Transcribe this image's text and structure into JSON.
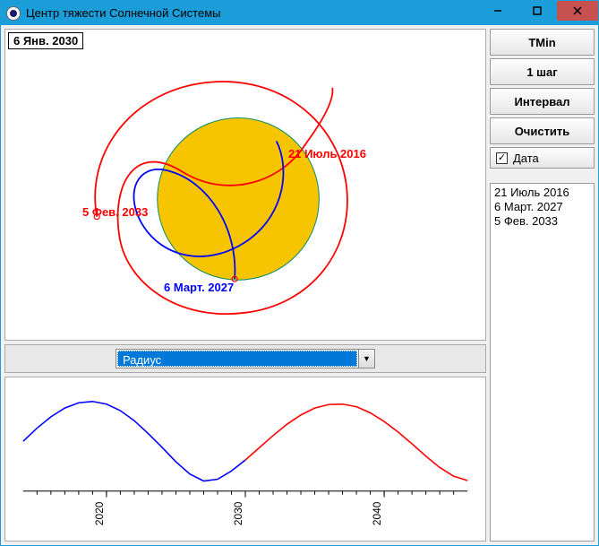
{
  "window": {
    "title": "Центр тяжести Солнечной Системы"
  },
  "canvas": {
    "current_date": "6 Янв. 2030",
    "labels": {
      "start": "21 Июль 2016",
      "mid": "6 Март. 2027",
      "end": "5 Фев. 2033"
    }
  },
  "dropdown": {
    "selected": "Радиус"
  },
  "side": {
    "buttons": {
      "tmin": "TMin",
      "step": "1 шаг",
      "interval": "Интервал",
      "clear": "Очистить"
    },
    "checkbox_label": "Дата",
    "checkbox_checked": true,
    "list_items": [
      "21 Июль 2016",
      "6 Март. 2027",
      "5 Фев. 2033"
    ]
  },
  "chart_data": {
    "type": "line",
    "xlabel": "",
    "ylabel": "",
    "x_ticks": [
      "2020",
      "2030",
      "2040"
    ],
    "x_range": [
      2014,
      2046
    ],
    "y_range": [
      0,
      2.2
    ],
    "series": [
      {
        "name": "radius",
        "current_x": 2030,
        "x": [
          2014,
          2015,
          2016,
          2017,
          2018,
          2019,
          2020,
          2021,
          2022,
          2023,
          2024,
          2025,
          2026,
          2027,
          2028,
          2029,
          2030,
          2031,
          2032,
          2033,
          2034,
          2035,
          2036,
          2037,
          2038,
          2039,
          2040,
          2041,
          2042,
          2043,
          2044,
          2045,
          2046
        ],
        "values": [
          1.1,
          1.4,
          1.66,
          1.86,
          1.98,
          2.01,
          1.95,
          1.8,
          1.57,
          1.28,
          0.96,
          0.63,
          0.35,
          0.19,
          0.23,
          0.42,
          0.67,
          0.95,
          1.23,
          1.49,
          1.7,
          1.86,
          1.94,
          1.95,
          1.89,
          1.75,
          1.55,
          1.31,
          1.04,
          0.76,
          0.5,
          0.3,
          0.2
        ]
      }
    ]
  }
}
